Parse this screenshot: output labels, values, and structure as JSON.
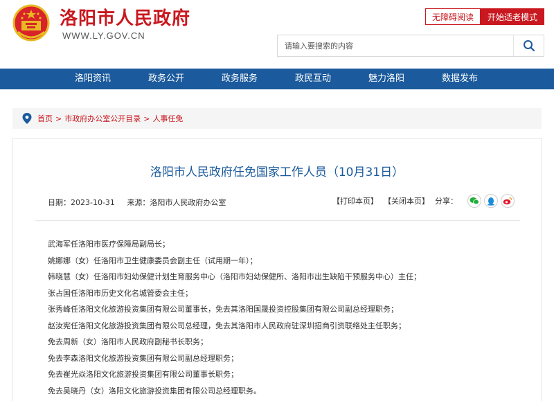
{
  "header": {
    "site_title": "洛阳市人民政府",
    "site_url": "WWW.LY.GOV.CN",
    "btn_accessible": "无障碍阅读",
    "btn_elder": "开始适老模式",
    "search_placeholder": "请输入要搜索的内容",
    "colors": {
      "brand_red": "#c9181f",
      "nav_blue": "#1b5a9c"
    }
  },
  "nav": {
    "items": [
      {
        "label": "洛阳资讯"
      },
      {
        "label": "政务公开"
      },
      {
        "label": "政务服务"
      },
      {
        "label": "政民互动"
      },
      {
        "label": "魅力洛阳"
      },
      {
        "label": "数据发布"
      }
    ]
  },
  "breadcrumb": {
    "items": [
      "首页",
      "市政府办公室公开目录",
      "人事任免"
    ],
    "separator": ">"
  },
  "article": {
    "title": "洛阳市人民政府任免国家工作人员（10月31日）",
    "date": "日期：2023-10-31",
    "source": "来源：洛阳市人民政府办公室",
    "print": "【打印本页】",
    "close": "【关闭本页】",
    "share": "分享：",
    "share_icons": [
      "wechat-icon",
      "qq-icon",
      "weibo-icon"
    ],
    "paragraphs": [
      "武海军任洛阳市医疗保障局副局长；",
      "姚娜娜（女）任洛阳市卫生健康委员会副主任（试用期一年）；",
      "韩晓慧（女）任洛阳市妇幼保健计划生育服务中心（洛阳市妇幼保健所、洛阳市出生缺陷干预服务中心）主任；",
      "张占国任洛阳市历史文化名城管委会主任；",
      "张秀峰任洛阳文化旅游投资集团有限公司董事长，免去其洛阳国晟投资控股集团有限公司副总经理职务；",
      "赵汝宪任洛阳文化旅游投资集团有限公司总经理，免去其洛阳市人民政府驻深圳招商引资联络处主任职务；",
      "免去周新（女）洛阳市人民政府副秘书长职务；",
      "免去李森洛阳文化旅游投资集团有限公司副总经理职务；",
      "免去崔光焱洛阳文化旅游投资集团有限公司董事长职务；",
      "免去吴晓丹（女）洛阳文化旅游投资集团有限公司总经理职务。"
    ]
  }
}
